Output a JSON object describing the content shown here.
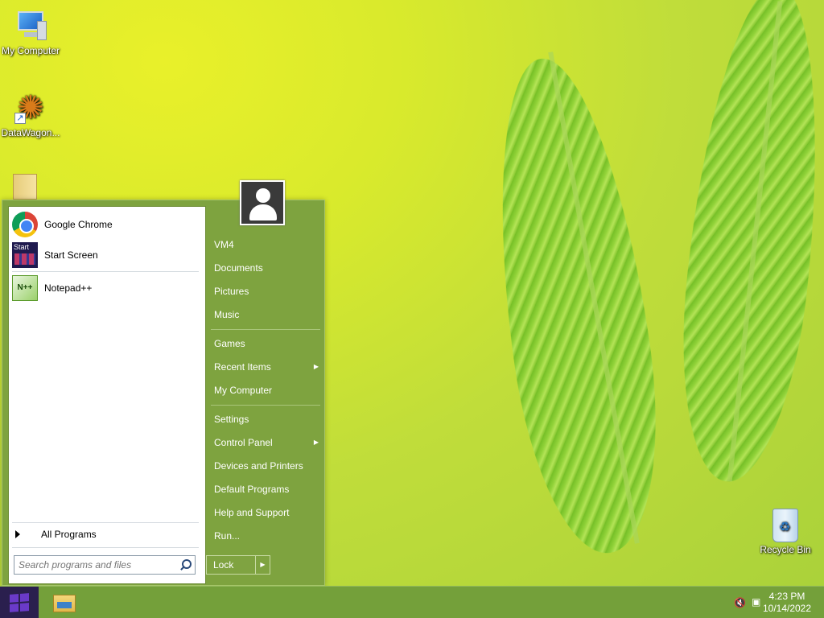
{
  "desktop": {
    "icons": [
      {
        "label": "My Computer"
      },
      {
        "label": "DataWagon..."
      },
      {
        "label": "Recycle Bin"
      }
    ]
  },
  "start_menu": {
    "pinned": [
      {
        "label": "Google Chrome",
        "icon": "chrome-icon"
      },
      {
        "label": "Start Screen",
        "icon": "start-screen-icon",
        "icon_text": "Start"
      },
      {
        "label": "Notepad++",
        "icon": "notepad-plus-plus-icon",
        "icon_text": "N++"
      }
    ],
    "all_programs_label": "All Programs",
    "search_placeholder": "Search programs and files",
    "right_items": {
      "user": "VM4",
      "documents": "Documents",
      "pictures": "Pictures",
      "music": "Music",
      "games": "Games",
      "recent_items": "Recent Items",
      "my_computer": "My Computer",
      "settings": "Settings",
      "control_panel": "Control Panel",
      "devices_printers": "Devices and Printers",
      "default_programs": "Default Programs",
      "help_support": "Help and Support",
      "run": "Run..."
    },
    "lock_label": "Lock",
    "submenu_glyph": "▶"
  },
  "taskbar": {
    "time": "4:23 PM",
    "date": "10/14/2022"
  },
  "colors": {
    "accent": "#7ea33f",
    "taskbar": "#74a03a",
    "start_button": "#2a1f4e"
  }
}
